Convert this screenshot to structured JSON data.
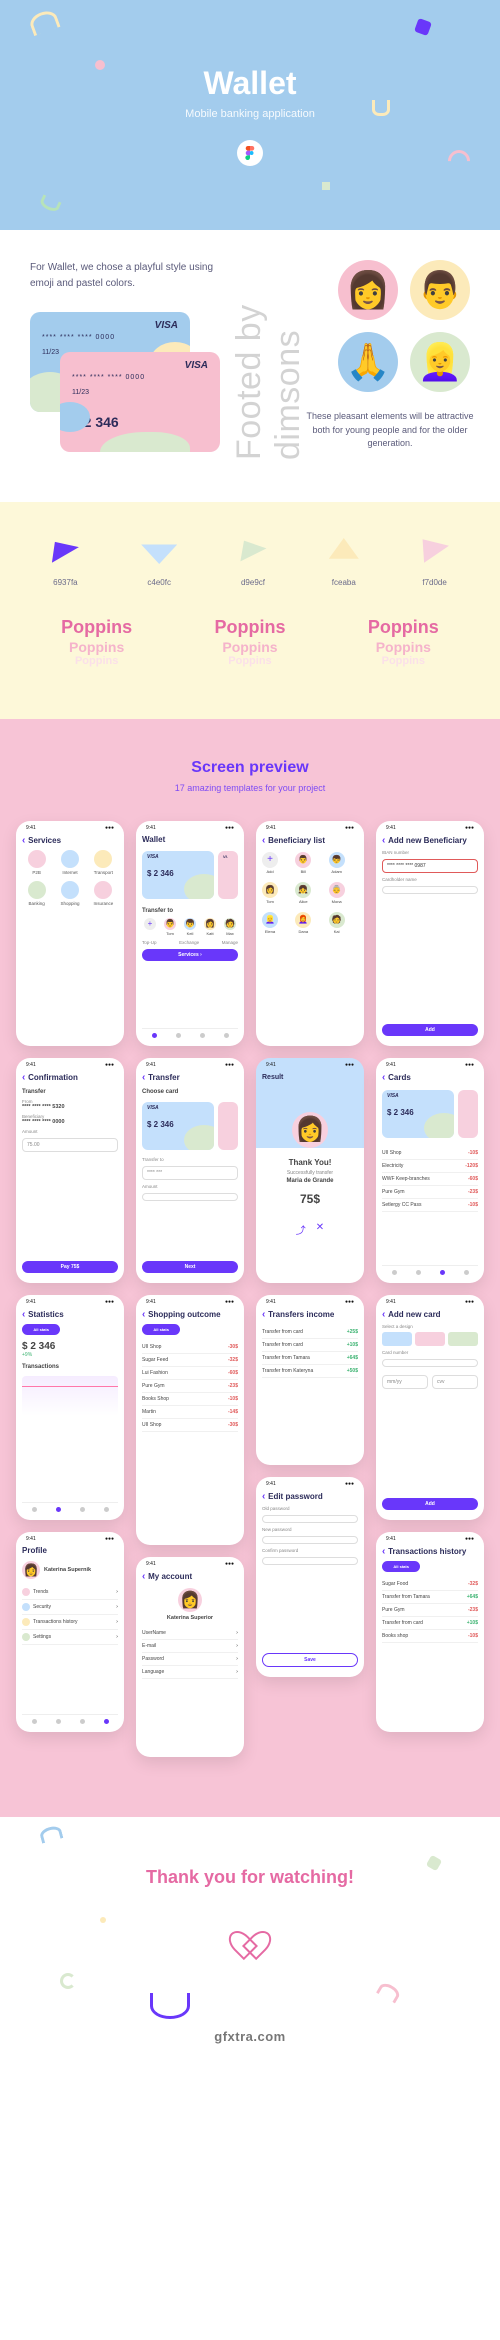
{
  "hero": {
    "title": "Wallet",
    "subtitle": "Mobile banking application"
  },
  "intro": {
    "text": "For Wallet, we chose a playful style using emoji and pastel colors.",
    "caption": "These pleasant elements will be attractive both for young people and for the older generation.",
    "card": {
      "brand": "VISA",
      "number": "**** **** **** 0000",
      "date": "11/23",
      "balance": "$ 2 346"
    }
  },
  "palette": {
    "swatches": [
      "6937fa",
      "c4e0fc",
      "d9e9cf",
      "fceaba",
      "f7d0de"
    ],
    "font_name": "Poppins"
  },
  "screens": {
    "title": "Screen preview",
    "subtitle": "17 amazing templates for your project",
    "common": {
      "visa": "VISA",
      "balance": "$ 2 346",
      "pay_btn": "Pay 75$",
      "next_btn": "Next",
      "add_btn": "Add",
      "save_btn": "Save",
      "add_card_btn": "Add",
      "services_btn": "Services   ›"
    },
    "wallet": {
      "title": "Wallet",
      "transfer_to": "Transfer to",
      "contacts": [
        "Tom",
        "Keil",
        "Katt",
        "Max"
      ],
      "services": "Services"
    },
    "services": {
      "title": "Services",
      "items": [
        "P2B",
        "Internet",
        "Transport",
        "Banking",
        "Shopping",
        "Insurance"
      ],
      "colors": [
        "#f7d0de",
        "#c4e0fc",
        "#fceaba",
        "#d9e9cf",
        "#c4e0fc",
        "#f7d0de"
      ]
    },
    "beneficiary": {
      "title": "Beneficiary list",
      "contacts": [
        "Add",
        "Bill",
        "Adam",
        "Tom",
        "Alice",
        "Mona",
        "Elena",
        "Dana",
        "Kai"
      ]
    },
    "add_beneficiary": {
      "title": "Add new Beneficiary",
      "field1": "IBAN number",
      "value1": "**** **** **** 0987",
      "field2": "Cardholder name"
    },
    "confirmation": {
      "title": "Confirmation",
      "transfer": "Transfer",
      "from_lbl": "From",
      "from": "**** **** **** 5320",
      "to_lbl": "Beneficiary",
      "to": "**** **** **** 0000",
      "amount_lbl": "Amount",
      "amount": "75.00"
    },
    "transfer": {
      "title": "Transfer",
      "choose": "Choose card",
      "to_lbl": "Transfer to",
      "amount_lbl": "Amount"
    },
    "result": {
      "title": "Result",
      "thank": "Thank You!",
      "sent": "Successfully transfer",
      "name": "Maria de Grande",
      "amount": "75$"
    },
    "cards": {
      "title": "Cards",
      "items": [
        "UII Shop",
        "Electricity",
        "WWF Keep-branches",
        "Pure Gym",
        "Setlergy CC Pass"
      ],
      "values": [
        "-10$",
        "-120$",
        "-60$",
        "-23$",
        "-10$"
      ]
    },
    "statistics": {
      "title": "Statistics",
      "tab_all": "All stats",
      "balance": "$ 2 346",
      "pct": "+9%",
      "trans": "Transactions"
    },
    "shopping": {
      "title": "Shopping outcome",
      "items": [
        "UII Shop",
        "Sugar Feed",
        "Lui Fashion",
        "Pure Gym",
        "Books Shop",
        "Martin",
        "UII Shop"
      ],
      "values": [
        "-30$",
        "-32$",
        "-60$",
        "-23$",
        "-10$",
        "-14$",
        "-30$"
      ]
    },
    "add_card": {
      "title": "Add new card",
      "design_lbl": "Select a design",
      "num_lbl": "Card number",
      "date_lbl": "mm/yy",
      "cvv_lbl": "cvv"
    },
    "profile": {
      "title": "Profile",
      "name": "Katerina Supernik",
      "items": [
        "Trends",
        "Security",
        "Transactions history",
        "Settings"
      ],
      "colors": [
        "#f7d0de",
        "#c4e0fc",
        "#fceaba",
        "#d9e9cf"
      ]
    },
    "account": {
      "title": "My account",
      "name": "Katerina Superior",
      "items": [
        "UserName",
        "E-mail",
        "Password",
        "Language"
      ]
    },
    "edit_password": {
      "title": "Edit password",
      "old": "Old password",
      "new": "New password",
      "confirm": "Confirm password"
    },
    "income": {
      "title": "Transfers income",
      "items": [
        "Transfer from card",
        "Transfer from card",
        "Transfer from Tamara",
        "Transfer from Kateryna"
      ],
      "values": [
        "+25$",
        "+10$",
        "+64$",
        "+50$"
      ]
    },
    "history": {
      "title": "Transactions history",
      "tab_all": "All stats",
      "items": [
        "Sugar Food",
        "Transfer from Tamara",
        "Pure Gym",
        "Transfer from card",
        "Books shop"
      ],
      "values": [
        "-32$",
        "+64$",
        "-23$",
        "+10$",
        "-10$"
      ]
    }
  },
  "footer": {
    "thanks": "Thank you for watching!"
  },
  "watermark": "Footed by dimsons",
  "site_link": "gfxtra.com"
}
